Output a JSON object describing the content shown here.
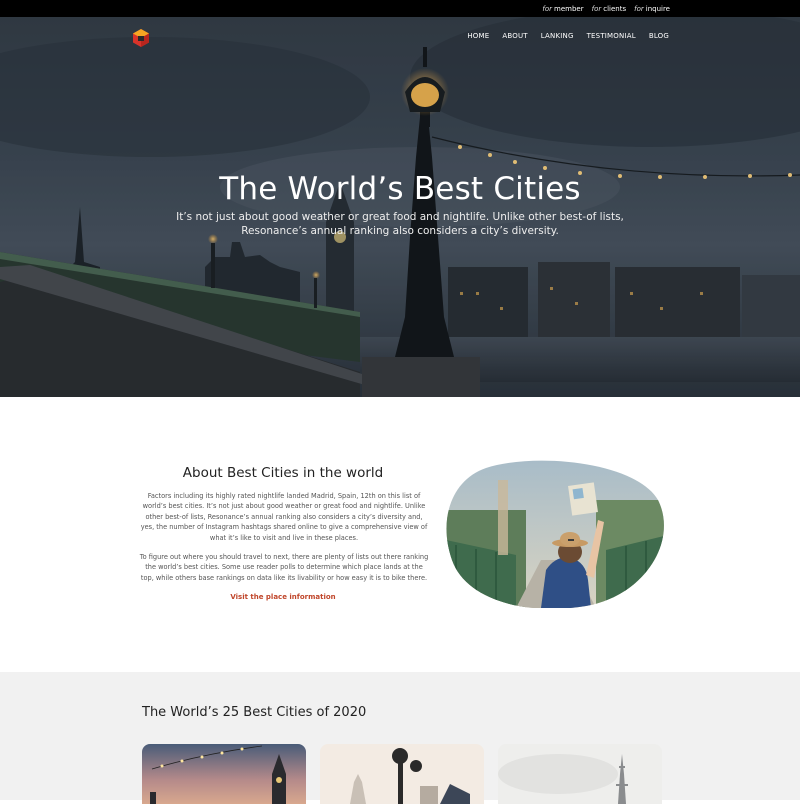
{
  "topbar": {
    "links": [
      {
        "prefix": "for",
        "label": "member"
      },
      {
        "prefix": "for",
        "label": "clients"
      },
      {
        "prefix": "for",
        "label": "inquire"
      }
    ]
  },
  "nav": {
    "items": [
      "HOME",
      "ABOUT",
      "LANKING",
      "TESTIMONIAL",
      "BLOG"
    ]
  },
  "hero": {
    "title": "The World’s Best Cities",
    "subtitle": "It’s not just about good weather or great food and nightlife. Unlike other best-of lists, Resonance’s annual ranking also considers a city’s diversity."
  },
  "about": {
    "title": "About Best Cities in the world",
    "paragraph1": "Factors including its highly rated nightlife landed Madrid, Spain, 12th on this list of world’s best cities. It’s not just about good weather or great food and nightlife. Unlike other best-of lists, Resonance’s annual ranking also considers a city’s diversity and, yes, the number of Instagram hashtags shared online to give a comprehensive view of what it’s like to visit and live in these places.",
    "paragraph2": "To figure out where you should travel to next, there are plenty of lists out there ranking the world’s best cities. Some use reader polls to determine which place lands at the top, while others base rankings on data like its livability or how easy it is to bike there.",
    "link": "Visit the place information"
  },
  "best": {
    "title": "The World’s 25 Best Cities of 2020"
  },
  "colors": {
    "accent": "#c0462b",
    "topbar": "#000000",
    "section_bg": "#f1f1f1"
  }
}
